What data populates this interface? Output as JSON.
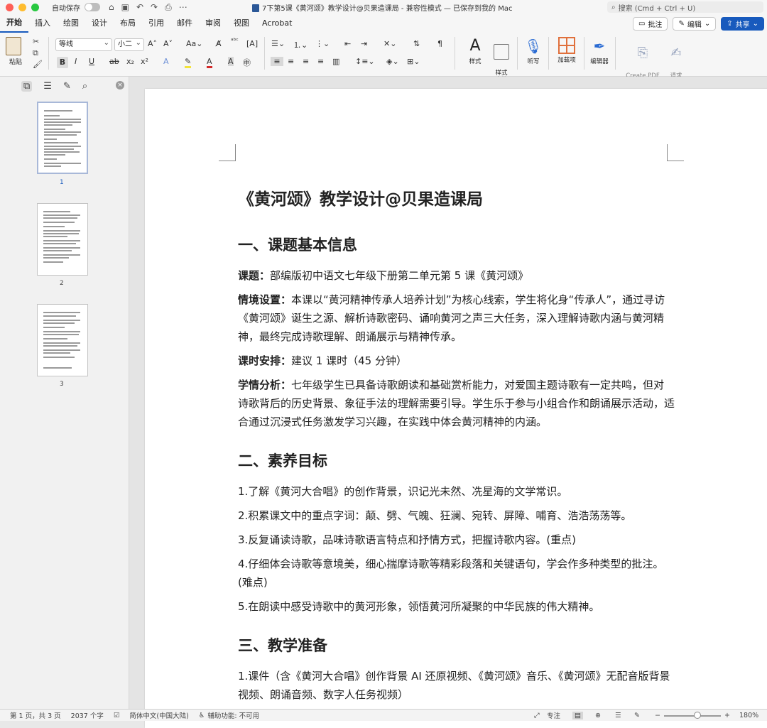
{
  "window": {
    "autosave_label": "自动保存",
    "title": "7下第5课《黄河颂》教学设计@贝果造课局  -  兼容性模式 — 已保存到我的 Mac",
    "search_placeholder": "搜索 (Cmd + Ctrl + U)"
  },
  "tabs": [
    "开始",
    "插入",
    "绘图",
    "设计",
    "布局",
    "引用",
    "邮件",
    "审阅",
    "视图",
    "Acrobat"
  ],
  "actions": {
    "comment": "批注",
    "edit": "编辑",
    "share": "共享"
  },
  "ribbon": {
    "paste": "粘贴",
    "font_name": "等线",
    "font_size": "小二",
    "styles": "样式",
    "styles_pane": "样式\n窗格",
    "dictate": "听写",
    "addins": "加载项",
    "editor": "编辑器",
    "create_pdf": "Create PDF\nand share link",
    "request_sign": "请求\n签名"
  },
  "nav": {
    "pages": [
      "1",
      "2",
      "3"
    ]
  },
  "document": {
    "title": "《黄河颂》教学设计@贝果造课局",
    "sections": [
      {
        "heading": "一、课题基本信息",
        "paragraphs": [
          {
            "label": "课题：",
            "text": "部编版初中语文七年级下册第二单元第 5 课《黄河颂》"
          },
          {
            "label": "情境设置：",
            "text": "本课以“黄河精神传承人培养计划”为核心线索，学生将化身“传承人”，通过寻访《黄河颂》诞生之源、解析诗歌密码、诵响黄河之声三大任务，深入理解诗歌内涵与黄河精神，最终完成诗歌理解、朗诵展示与精神传承。"
          },
          {
            "label": "课时安排：",
            "text": "建议 1 课时（45 分钟）"
          },
          {
            "label": "学情分析：",
            "text": "七年级学生已具备诗歌朗读和基础赏析能力，对爱国主题诗歌有一定共鸣，但对诗歌背后的历史背景、象征手法的理解需要引导。学生乐于参与小组合作和朗诵展示活动，适合通过沉浸式任务激发学习兴趣，在实践中体会黄河精神的内涵。"
          }
        ]
      },
      {
        "heading": "二、素养目标",
        "paragraphs": [
          {
            "label": "",
            "text": "1.了解《黄河大合唱》的创作背景，识记光未然、冼星海的文学常识。"
          },
          {
            "label": "",
            "text": "2.积累课文中的重点字词：颠、劈、气魄、狂澜、宛转、屏障、哺育、浩浩荡荡等。"
          },
          {
            "label": "",
            "text": "3.反复诵读诗歌，品味诗歌语言特点和抒情方式，把握诗歌内容。(重点)"
          },
          {
            "label": "",
            "text": "4.仔细体会诗歌等意境美，细心揣摩诗歌等精彩段落和关键语句，学会作多种类型的批注。(难点)"
          },
          {
            "label": "",
            "text": "5.在朗读中感受诗歌中的黄河形象，领悟黄河所凝聚的中华民族的伟大精神。"
          }
        ]
      },
      {
        "heading": "三、教学准备",
        "paragraphs": [
          {
            "label": "",
            "text": "1.课件（含《黄河大合唱》创作背景 AI 还原视频、《黄河颂》音乐、《黄河颂》无配音版背景视频、朗诵音频、数字人任务视频）"
          }
        ]
      }
    ]
  },
  "status": {
    "page": "第 1 页，共 3 页",
    "words": "2037 个字",
    "language": "简体中文(中国大陆)",
    "accessibility": "辅助功能: 不可用",
    "focus": "专注",
    "zoom": "180%"
  }
}
